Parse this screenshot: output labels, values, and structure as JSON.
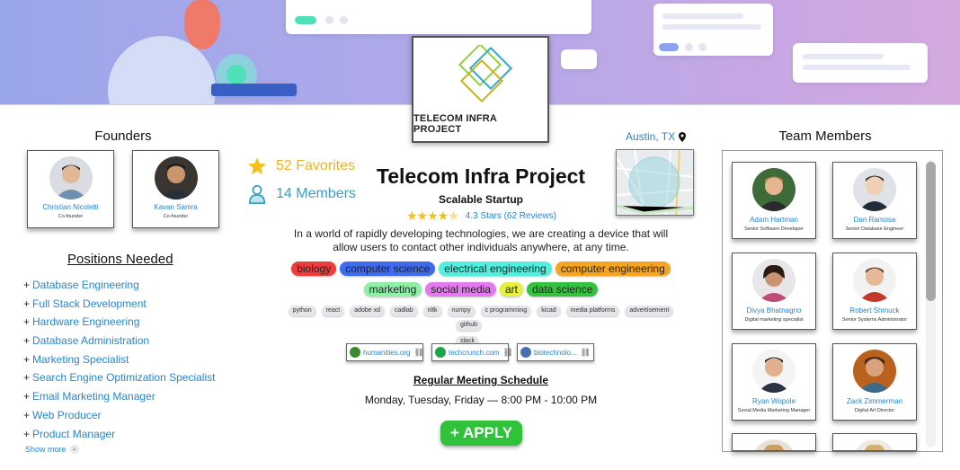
{
  "company": {
    "logo_text": "TELECOM INFRA PROJECT",
    "name": "Telecom Infra Project",
    "type": "Scalable Startup",
    "rating_text": "4.3 Stars (62 Reviews)",
    "rating_value": 4.3,
    "description": "In a world of rapidly developing technologies, we are creating a device that will allow users to contact other individuals anywhere, at any time.",
    "location": "Austin, TX"
  },
  "stats": {
    "favorites": "52 Favorites",
    "members": "14 Members"
  },
  "founders": {
    "heading": "Founders",
    "people": [
      {
        "name": "Christian Nicoletti",
        "role": "Co-founder"
      },
      {
        "name": "Kavan Samra",
        "role": "Co-founder"
      }
    ]
  },
  "tags": [
    {
      "label": "biology",
      "color": "#ef3b3b"
    },
    {
      "label": "computer science",
      "color": "#3e6af0"
    },
    {
      "label": "electrical engineering",
      "color": "#4ff0e0"
    },
    {
      "label": "computer engineering",
      "color": "#f7a51e"
    },
    {
      "label": "marketing",
      "color": "#8ef0a6"
    },
    {
      "label": "social media",
      "color": "#e47af0"
    },
    {
      "label": "art",
      "color": "#e4f03a"
    },
    {
      "label": "data science",
      "color": "#35c23f"
    }
  ],
  "skills": [
    "python",
    "react",
    "adobe xd",
    "cadlab",
    "nltk",
    "numpy",
    "c programming",
    "kicad",
    "media platforms",
    "advertisement",
    "github",
    "slack"
  ],
  "links": [
    {
      "label": "humanities.org",
      "color": "#3b8a2e"
    },
    {
      "label": "techcrunch.com",
      "color": "#1fa34a"
    },
    {
      "label": "biotechnolo...",
      "color": "#4a6fb0"
    }
  ],
  "meeting": {
    "title": "Regular Meeting Schedule",
    "time": "Monday, Tuesday, Friday  —  8:00 PM - 10:00 PM"
  },
  "apply_label": "+ APPLY",
  "positions": {
    "heading": "Positions Needed",
    "items": [
      "Database Engineering",
      "Full Stack Development",
      "Hardware Engineering",
      "Database Administration",
      "Marketing Specialist",
      "Search Engine Optimization Specialist",
      "Email Marketing Manager",
      "Web Producer",
      "Product Manager"
    ],
    "show_more": "Show more"
  },
  "team": {
    "heading": "Team Members",
    "members": [
      {
        "name": "Adam Hartman",
        "role": "Senior Software Developer"
      },
      {
        "name": "Dan Ramosa",
        "role": "Senior Database Engineer"
      },
      {
        "name": "Divya Bhatnagno",
        "role": "Digital marketing specialist"
      },
      {
        "name": "Robert Shmuck",
        "role": "Senior Systems Administrator"
      },
      {
        "name": "Ryan Wopole",
        "role": "Social Media Marketing Manager"
      },
      {
        "name": "Zack Zimmerman",
        "role": "Digital Art Director"
      }
    ]
  }
}
